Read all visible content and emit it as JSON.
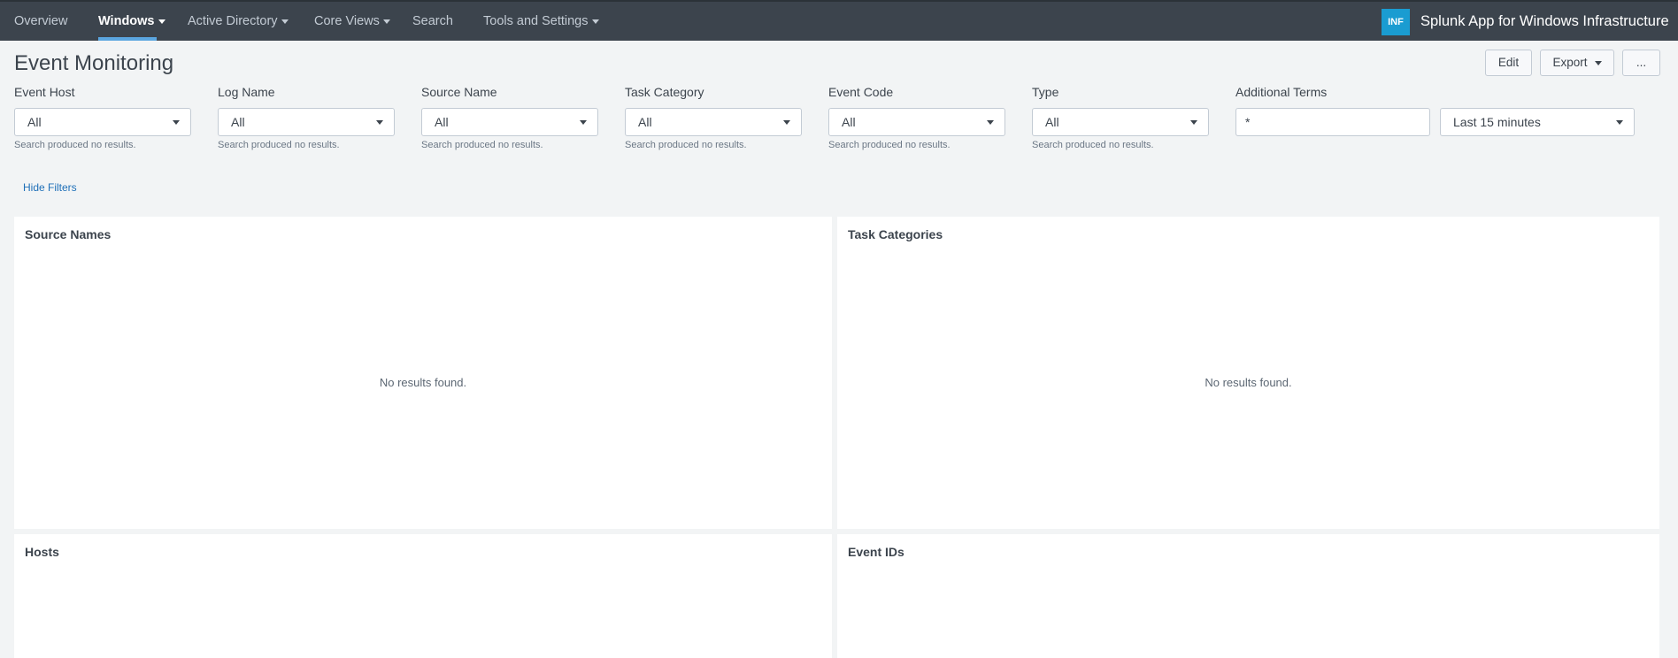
{
  "nav": {
    "items": [
      {
        "label": "Overview",
        "dropdown": false
      },
      {
        "label": "Windows",
        "dropdown": true,
        "active": true
      },
      {
        "label": "Active Directory",
        "dropdown": true
      },
      {
        "label": "Core Views",
        "dropdown": true
      },
      {
        "label": "Search",
        "dropdown": false
      },
      {
        "label": "Tools and Settings",
        "dropdown": true
      }
    ],
    "app_badge": "INF",
    "app_title": "Splunk App for Windows Infrastructure"
  },
  "page": {
    "title": "Event Monitoring",
    "buttons": {
      "edit": "Edit",
      "export": "Export",
      "more": "..."
    }
  },
  "filters": [
    {
      "label": "Event Host",
      "value": "All",
      "note": "Search produced no results."
    },
    {
      "label": "Log Name",
      "value": "All",
      "note": "Search produced no results."
    },
    {
      "label": "Source Name",
      "value": "All",
      "note": "Search produced no results."
    },
    {
      "label": "Task Category",
      "value": "All",
      "note": "Search produced no results."
    },
    {
      "label": "Event Code",
      "value": "All",
      "note": "Search produced no results."
    },
    {
      "label": "Type",
      "value": "All",
      "note": "Search produced no results."
    }
  ],
  "additional_terms": {
    "label": "Additional Terms",
    "value": "*"
  },
  "time_range": {
    "value": "Last 15 minutes"
  },
  "hide_filters": "Hide Filters",
  "panels": [
    {
      "title": "Source Names",
      "empty": "No results found."
    },
    {
      "title": "Task Categories",
      "empty": "No results found."
    },
    {
      "title": "Hosts"
    },
    {
      "title": "Event IDs"
    }
  ],
  "colors": {
    "appbar": "#3c444d",
    "accent": "#5ba6e0",
    "badge": "#1a9cd1",
    "link": "#1e6fb8",
    "background": "#f2f4f5"
  }
}
